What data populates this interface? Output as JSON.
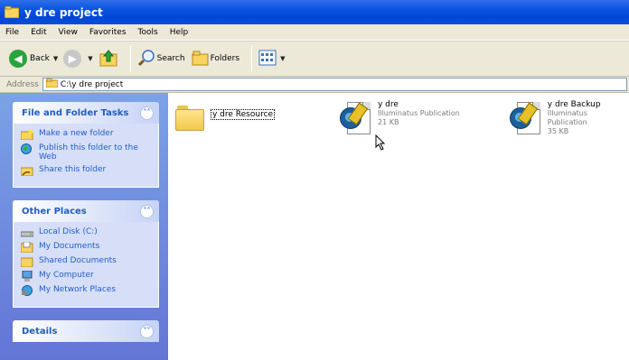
{
  "window": {
    "title": "y dre project"
  },
  "menu": [
    "File",
    "Edit",
    "View",
    "Favorites",
    "Tools",
    "Help"
  ],
  "toolbar": {
    "back_label": "Back",
    "search_label": "Search",
    "folders_label": "Folders"
  },
  "address": {
    "label": "Address",
    "path": "C:\\y dre project"
  },
  "sidebar": {
    "tasks": {
      "title": "File and Folder Tasks",
      "items": [
        "Make a new folder",
        "Publish this folder to the Web",
        "Share this folder"
      ]
    },
    "places": {
      "title": "Other Places",
      "items": [
        "Local Disk (C:)",
        "My Documents",
        "Shared Documents",
        "My Computer",
        "My Network Places"
      ]
    },
    "details": {
      "title": "Details"
    }
  },
  "files": [
    {
      "name": "y dre Resource",
      "type": "",
      "size": ""
    },
    {
      "name": "y dre",
      "type": "Illuminatus Publication",
      "size": "21 KB"
    },
    {
      "name": "y dre Backup",
      "type": "Illuminatus Publication",
      "size": "35 KB"
    }
  ],
  "colors": {
    "titlebar": "#0a53e0",
    "sidebar": "#6375d6",
    "link": "#215dc6"
  }
}
